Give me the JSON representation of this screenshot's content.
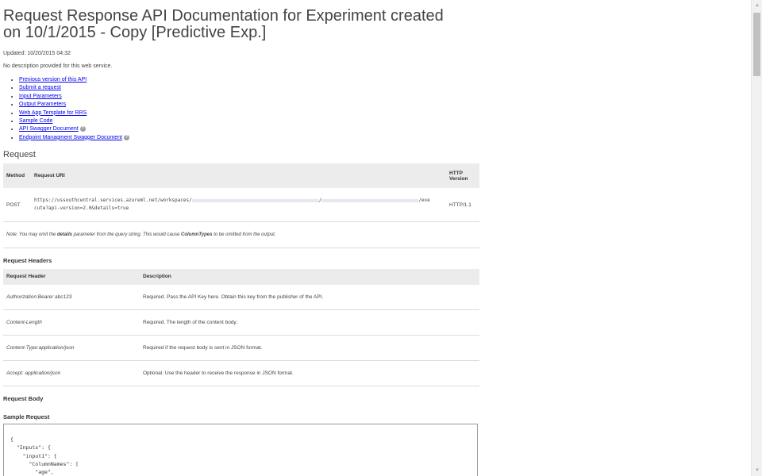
{
  "page": {
    "title": "Request Response API Documentation for Experiment created on 10/1/2015 - Copy [Predictive Exp.]",
    "updated": "Updated: 10/20/2015 04:32",
    "description": "No description provided for this web service."
  },
  "nav_links": [
    {
      "label": "Previous version of this API"
    },
    {
      "label": "Submit a request"
    },
    {
      "label": "Input Parameters"
    },
    {
      "label": "Output Parameters"
    },
    {
      "label": "Web App Template for RRS"
    },
    {
      "label": "Sample Code"
    },
    {
      "label": "API Swagger Document",
      "help": "?"
    },
    {
      "label": "Endpoint Managment Swagger Document",
      "help": "?"
    }
  ],
  "request": {
    "heading": "Request",
    "columns": [
      "Method",
      "Request URI",
      "HTTP Version"
    ],
    "method": "POST",
    "uri_part1": "https://ussouthcentral.services.azureml.net/workspaces/",
    "uri_sep": "/",
    "uri_part2": "/exe",
    "uri_part3": "cute?api-version=2.0&details=true",
    "http_version": "HTTP/1.1",
    "note_prefix": "Note: You may omit the ",
    "note_bold1": "details",
    "note_mid": " parameter from the query string. This would cause ",
    "note_bold2": "ColumnTypes",
    "note_suffix": " to be omitted from the output."
  },
  "request_headers": {
    "heading": "Request Headers",
    "columns": [
      "Request Header",
      "Description"
    ],
    "rows": [
      {
        "header": "Authorization:Bearer abc123",
        "description": "Required. Pass the API Key here. Obtain this key from the publisher of the API."
      },
      {
        "header": "Content-Length",
        "description": "Required. The length of the content body."
      },
      {
        "header": "Content-Type:application/json",
        "description": "Required if the request body is sent in JSON format."
      },
      {
        "header": "Accept: application/json",
        "description": "Optional. Use the header to receive the response in JSON format."
      }
    ]
  },
  "request_body": {
    "heading": "Request Body",
    "sample_heading": "Sample Request",
    "sample_lines": [
      "{",
      "  \"Inputs\": {",
      "    \"input1\": {",
      "      \"ColumnNames\": [",
      "        \"age\","
    ]
  },
  "scrollbar": {
    "up_icon": "▲",
    "down_icon": "▼"
  }
}
